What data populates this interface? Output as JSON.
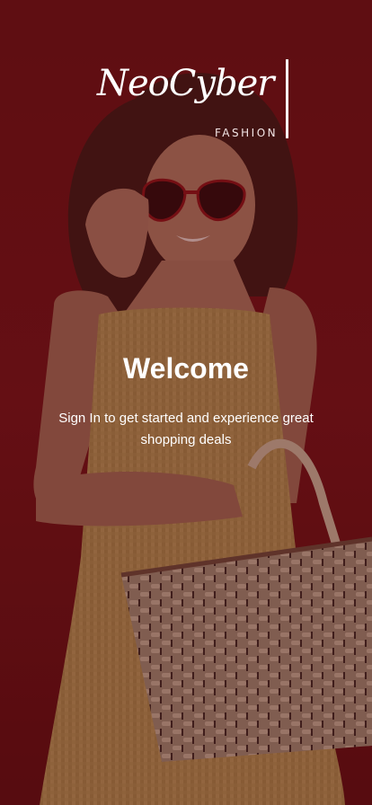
{
  "brand": {
    "name": "NeoCyber",
    "tagline": "FASHION"
  },
  "welcome": {
    "title": "Welcome",
    "subtitle": "Sign In to get started and experience great shopping deals"
  },
  "colors": {
    "background": "#6e1216",
    "overlay": "#5a0d10",
    "text": "#ffffff",
    "dress": "#c9a35a",
    "basket": "#b9a48b"
  }
}
